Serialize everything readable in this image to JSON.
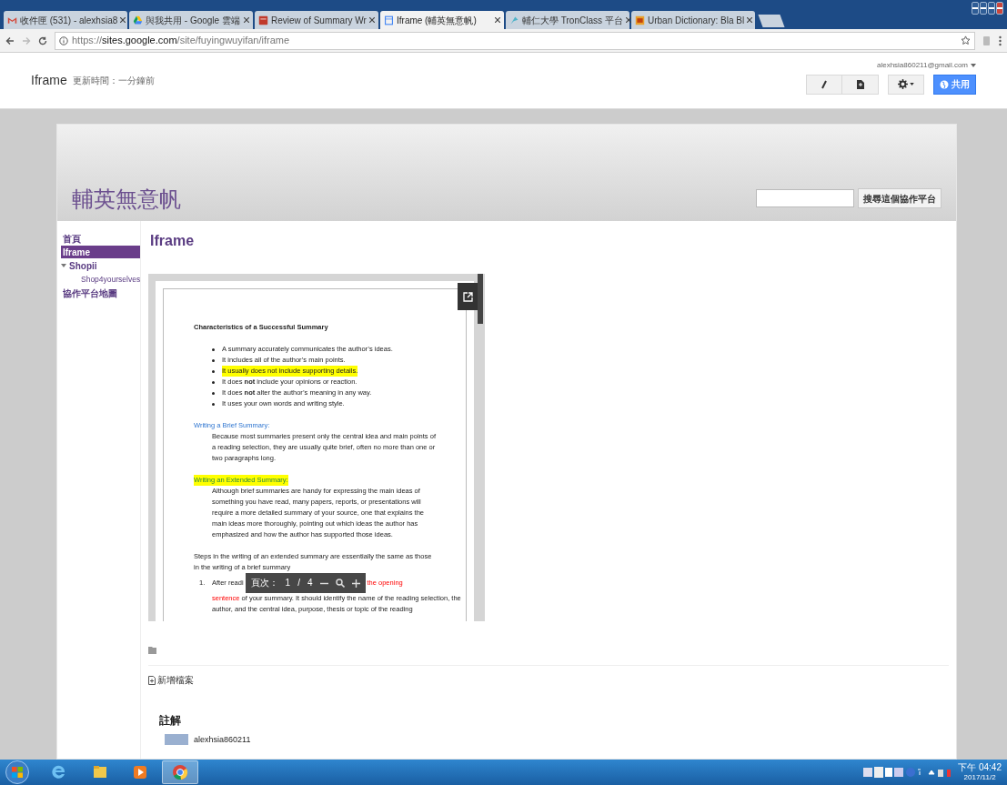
{
  "browser": {
    "tabs": [
      {
        "kind": "gmail",
        "label": "收件匣 (531) - alexhsia8",
        "selected": false
      },
      {
        "kind": "drive",
        "label": "與我共用 - Google 雲端",
        "selected": false
      },
      {
        "kind": "pdf",
        "label": "Review of Summary Wr",
        "selected": false
      },
      {
        "kind": "sites",
        "label": "Iframe (輔英無意帆)",
        "selected": true
      },
      {
        "kind": "tron",
        "label": "輔仁大學 TronClass 平台",
        "selected": false
      },
      {
        "kind": "ud",
        "label": "Urban Dictionary: Bla Bl",
        "selected": false
      }
    ],
    "address": {
      "scheme": "https://",
      "host": "sites.google.com",
      "path": "/site/fuyingwuyifan/iframe"
    }
  },
  "site_header": {
    "page_title": "Iframe",
    "updated": "更新時間：一分鐘前",
    "account": "alexhsia860211@gmail.com",
    "share_button": "共用"
  },
  "site": {
    "name": "輔英無意帆",
    "search_button": "搜尋這個協作平台",
    "nav": [
      {
        "label": "首頁",
        "selected": false
      },
      {
        "label": "Iframe",
        "selected": true
      },
      {
        "label": "Shopii",
        "selected": false,
        "expanded": true,
        "children": [
          {
            "label": "Shop4yourselves",
            "selected": false
          }
        ]
      },
      {
        "label": "協作平台地圖",
        "selected": false
      }
    ]
  },
  "page": {
    "title": "Iframe",
    "document": [
      {
        "kind": "title",
        "text": "Characteristics of a Successful Summary"
      },
      {
        "kind": "bullets",
        "items": [
          {
            "text": "A summary accurately communicates the author’s ideas.",
            "highlighted": false
          },
          {
            "text": "It includes all of the author’s main points.",
            "highlighted": false
          },
          {
            "text": "It usually does not include supporting details.",
            "highlighted": true
          },
          {
            "text": "It does **not** include your opinions or reaction.",
            "highlighted": false
          },
          {
            "text": "It does **not** alter the author’s meaning in any way.",
            "highlighted": false
          },
          {
            "text": "It uses your own words and writing style.",
            "highlighted": false
          }
        ]
      },
      {
        "kind": "heading",
        "text": "Writing a Brief Summary:",
        "highlighted": false
      },
      {
        "kind": "indented",
        "text": "Because most summaries present only the central idea and main points of a reading selection, they are usually quite brief, often no more than one or two paragraphs long."
      },
      {
        "kind": "heading",
        "text": "Writing an Extended Summary:",
        "highlighted": true
      },
      {
        "kind": "indented",
        "text": "Although brief summaries are handy for expressing the main ideas of something you have read, many papers, reports, or presentations will require a more detailed summary of your source, one that explains the main ideas more thoroughly, pointing out which ideas the author has emphasized and how the author has supported those ideas."
      },
      {
        "kind": "paragraph",
        "text": "Steps in the writing of an extended summary are essentially the same as those in the writing of a brief summary"
      },
      {
        "kind": "step",
        "number": "1.",
        "before_toolbar": "After readi",
        "after_toolbar": "the opening",
        "after_emphasis": true,
        "lines": [
          [
            {
              "text": "sentence",
              "emphasis": true
            },
            {
              "text": " of your summary. It should identify the name of the reading selection, the",
              "emphasis": false
            }
          ],
          [
            {
              "text": "author, and the central idea, purpose, thesis or topic of the reading",
              "emphasis": false
            }
          ]
        ]
      }
    ],
    "viewer_toolbar": {
      "label": "頁次：",
      "page": "1",
      "separator": "/",
      "total": "4"
    },
    "add_file": "新增檔案",
    "comments_heading": "註解",
    "comment_author": "alexhsia860211"
  },
  "taskbar": {
    "apps": [
      {
        "kind": "ie",
        "selected": false
      },
      {
        "kind": "explorer",
        "selected": false
      },
      {
        "kind": "media",
        "selected": false
      },
      {
        "kind": "chrome",
        "selected": true
      }
    ],
    "time": "下午 04:42",
    "date": "2017/11/2"
  }
}
